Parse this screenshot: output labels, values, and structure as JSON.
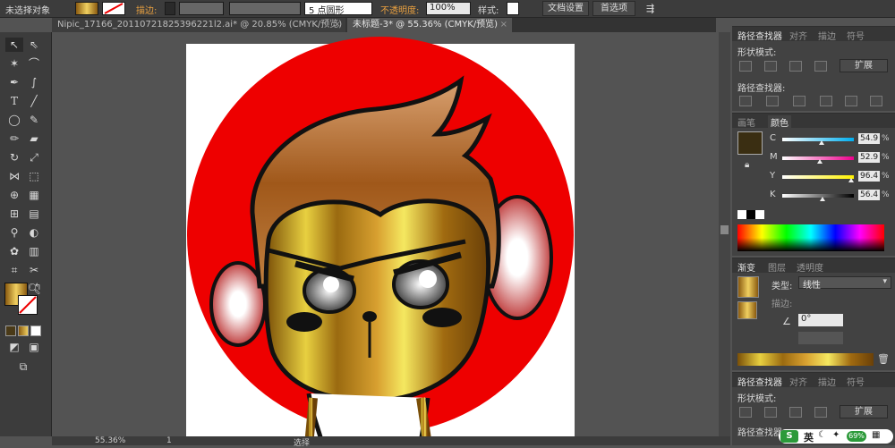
{
  "toolbar": {
    "status": "未选择对象",
    "stroke_label": "描边:",
    "brush": "5 点圆形",
    "opacity_label": "不透明度:",
    "opacity": "100%",
    "style_label": "样式:",
    "doc_setup": "文档设置",
    "prefs": "首选项"
  },
  "tabs": [
    {
      "label": "Nipic_17166_20110721825396221l2.ai* @ 20.85% (CMYK/预览)",
      "active": false
    },
    {
      "label": "未标题-3* @ 55.36% (CMYK/预览)",
      "active": true
    }
  ],
  "status": {
    "zoom": "55.36%",
    "page": "1",
    "tool": "选择"
  },
  "pathfinder": {
    "tabs": [
      "路径查找器",
      "对齐",
      "描边",
      "符号"
    ],
    "shape_modes": "形状模式:",
    "pathfinders": "路径查找器:",
    "expand": "扩展"
  },
  "color": {
    "tabs": [
      "画笔",
      "颜色"
    ],
    "channels": [
      {
        "name": "C",
        "value": "54.9",
        "fraction": 0.55,
        "grad": "linear-gradient(to right,#fff,#00aeef)"
      },
      {
        "name": "M",
        "value": "52.9",
        "fraction": 0.53,
        "grad": "linear-gradient(to right,#fff,#ec008c)"
      },
      {
        "name": "Y",
        "value": "96.4",
        "fraction": 0.96,
        "grad": "linear-gradient(to right,#fff,#fff200)"
      },
      {
        "name": "K",
        "value": "56.4",
        "fraction": 0.56,
        "grad": "linear-gradient(to right,#fff,#000)"
      }
    ],
    "percent": "%",
    "swatch": "#3a2e12"
  },
  "gradient": {
    "tabs": [
      "渐变",
      "图层",
      "透明度"
    ],
    "type_label": "类型:",
    "type": "线性",
    "stroke_label": "描边:",
    "angle": "0°"
  },
  "pathfinder2": {
    "tabs": [
      "路径查找器",
      "对齐",
      "描边",
      "符号"
    ],
    "shape_modes": "形状模式:",
    "pathfinders": "路径查找器:",
    "expand": "扩展"
  },
  "ime": {
    "lang": "英",
    "battery": "69%"
  }
}
